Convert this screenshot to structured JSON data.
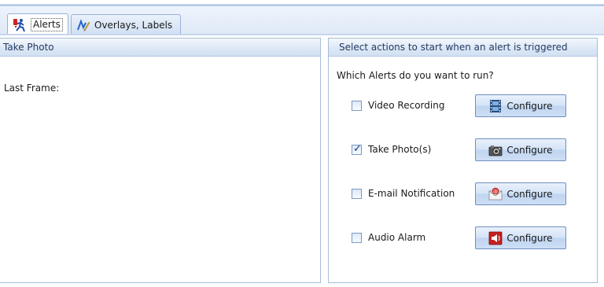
{
  "tabs": [
    {
      "label": "Alerts",
      "icon": "alerts-running-figure-icon",
      "active": true
    },
    {
      "label": "Overlays, Labels",
      "icon": "pencil-overlay-icon",
      "active": false
    }
  ],
  "left_panel": {
    "title": "Take Photo",
    "last_frame_label": "Last Frame:"
  },
  "right_panel": {
    "title": "Select actions to start when an alert is triggered",
    "question": "Which Alerts do you want to run?",
    "actions": [
      {
        "label": "Video Recording",
        "checked": false,
        "button_label": "Configure",
        "icon": "film-icon"
      },
      {
        "label": "Take Photo(s)",
        "checked": true,
        "button_label": "Configure",
        "icon": "camera-icon"
      },
      {
        "label": "E-mail Notification",
        "checked": false,
        "button_label": "Configure",
        "icon": "email-icon"
      },
      {
        "label": "Audio Alarm",
        "checked": false,
        "button_label": "Configure",
        "icon": "speaker-icon"
      }
    ]
  },
  "colors": {
    "accent": "#6d8fc0",
    "header_text": "#243a62",
    "border": "#a7bcd8"
  }
}
